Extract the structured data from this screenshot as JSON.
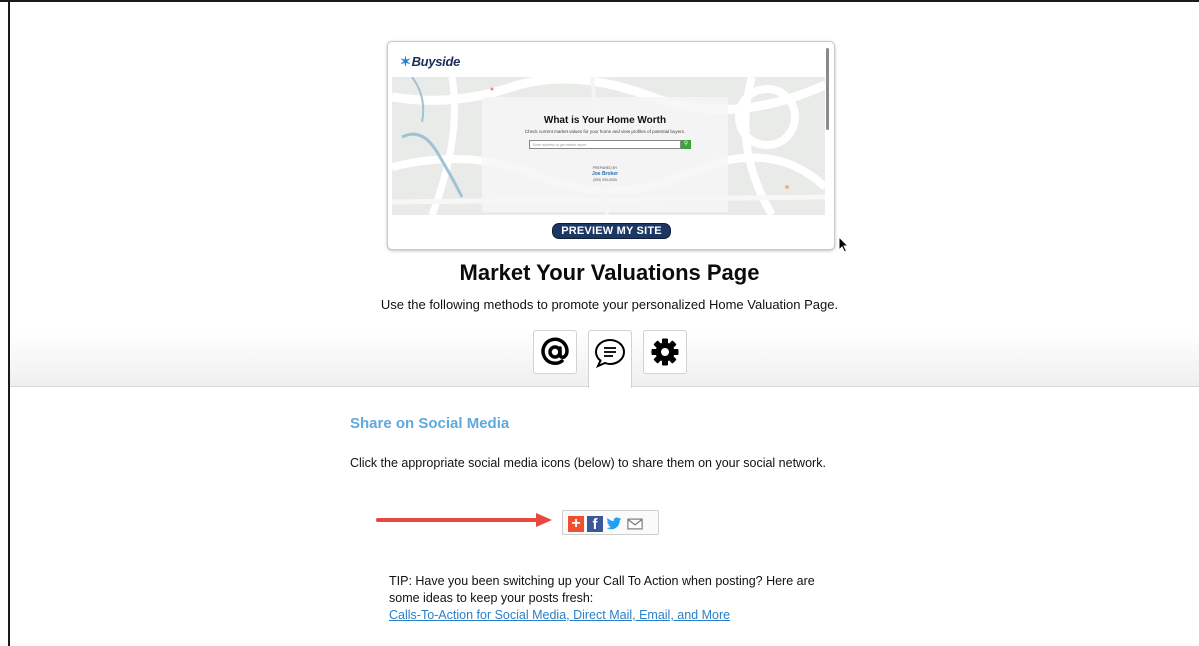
{
  "preview": {
    "logo_text": "Buyside",
    "logo_mark": "✶",
    "panel_title": "What is Your Home Worth",
    "panel_subtitle": "Check current market values for your home and view profiles of potential buyers.",
    "input_placeholder": "Enter address to get market report",
    "prepared_by": "PREPARED BY",
    "agent_name": "Joe Broker",
    "agent_phone": "(555) 555-5555",
    "button_label": "PREVIEW MY SITE"
  },
  "header": {
    "title": "Market Your Valuations Page",
    "subtitle": "Use the following methods to promote your personalized Home Valuation Page."
  },
  "tabs": [
    {
      "icon": "at-sign-icon",
      "active": false
    },
    {
      "icon": "chat-bubble-icon",
      "active": true
    },
    {
      "icon": "gear-icon",
      "active": false
    }
  ],
  "section": {
    "title": "Share on Social Media",
    "description": "Click the appropriate social media icons (below) to share them on your social network."
  },
  "share_buttons": [
    {
      "icon": "add-share-icon",
      "color": "#f0502f"
    },
    {
      "icon": "facebook-icon",
      "color": "#3b5998"
    },
    {
      "icon": "twitter-icon",
      "color": "#1da1f2"
    },
    {
      "icon": "email-icon",
      "color": "#777777"
    }
  ],
  "tip": {
    "text": "TIP: Have you been switching up your Call To Action when posting? Here are some ideas to keep your posts fresh:",
    "link_text": "Calls-To-Action for Social Media, Direct Mail, Email, and More"
  },
  "colors": {
    "accent_blue": "#5fa9dc",
    "navy": "#1d3765",
    "arrow_red": "#e8473f"
  }
}
